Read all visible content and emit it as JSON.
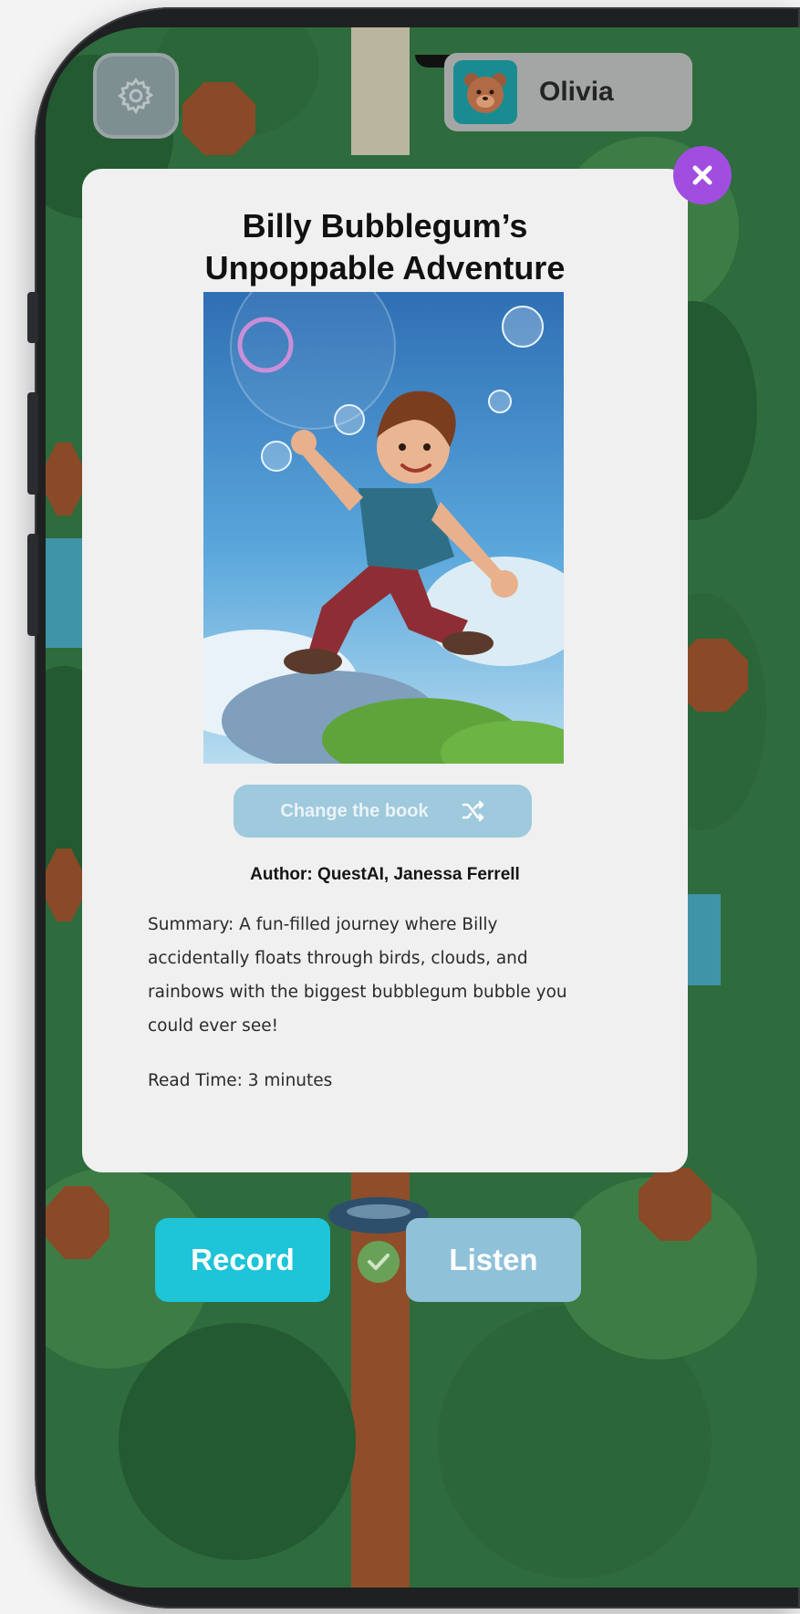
{
  "header": {
    "user_name": "Olivia",
    "settings_icon": "gear-icon",
    "avatar_icon": "bear-avatar-icon"
  },
  "modal": {
    "title_line1": "Billy Bubblegum’s",
    "title_line2": "Unpoppable Adventure",
    "change_book_label": "Change the book",
    "change_book_icon": "shuffle-icon",
    "author": "Author: QuestAI, Janessa Ferrell",
    "summary": "Summary: A fun-filled journey where Billy accidentally floats through birds, clouds, and rainbows with the biggest bubblegum bubble you could ever see!",
    "read_time": "Read Time: 3 minutes",
    "close_icon": "close-icon"
  },
  "actions": {
    "record_label": "Record",
    "listen_label": "Listen",
    "status_icon": "check-icon"
  },
  "colors": {
    "accent_purple": "#a04de0",
    "record_cyan": "#1ec4d7",
    "listen_blue": "#8fc1d9",
    "map_green": "#2e6b3d"
  }
}
